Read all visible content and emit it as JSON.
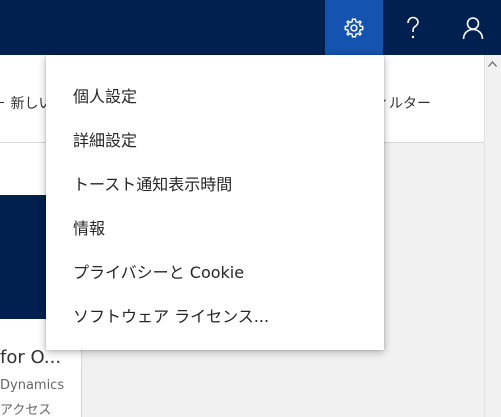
{
  "topbar": {
    "settings_icon": "gear-icon",
    "help_icon": "question-mark-icon",
    "user_icon": "person-icon",
    "bar_color": "#002050",
    "active_color": "#1453b0"
  },
  "background": {
    "command_new_label": "＋ 新しい",
    "command_filter_label": "ィルター",
    "card_title": "for O...",
    "card_line1": "Dynamics",
    "card_line2": "アクセス"
  },
  "settings_menu": {
    "items": [
      {
        "label": "個人設定"
      },
      {
        "label": "詳細設定"
      },
      {
        "label": "トースト通知表示時間"
      },
      {
        "label": "情報"
      },
      {
        "label": "プライバシーと Cookie"
      },
      {
        "label": "ソフトウェア ライセンス..."
      }
    ]
  }
}
